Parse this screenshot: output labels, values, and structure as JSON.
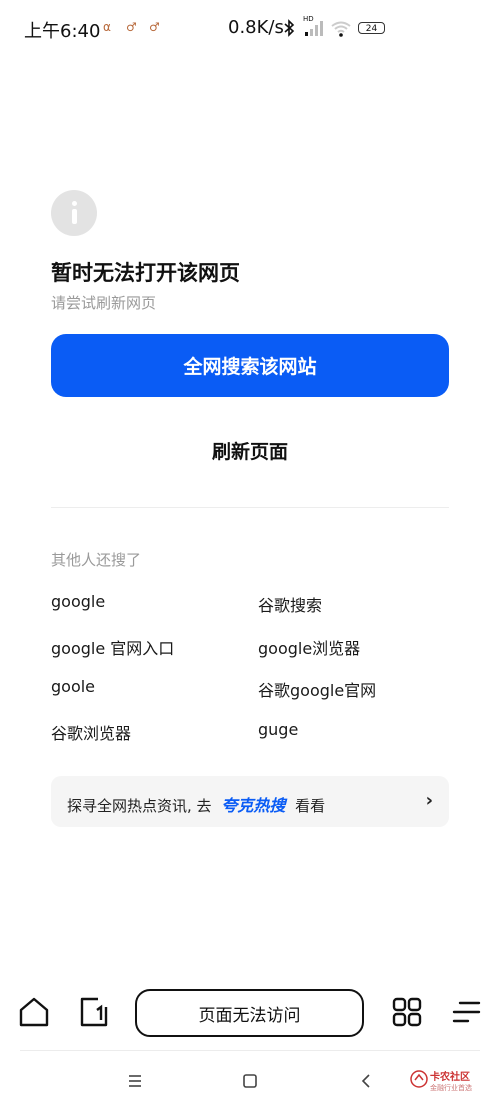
{
  "status_bar": {
    "time": "上午6:40",
    "mini_icons": [
      "α",
      "♂",
      "♂"
    ],
    "net_speed": "0.8K/s",
    "signal_label": "HD",
    "battery": "24"
  },
  "error": {
    "title": "暂时无法打开该网页",
    "subtitle": "请尝试刷新网页",
    "search_button": "全网搜索该网站",
    "refresh_button": "刷新页面"
  },
  "suggestions": {
    "title": "其他人还搜了",
    "items": [
      "google",
      "谷歌搜索",
      "google 官网入口",
      "google浏览器",
      "goole",
      "谷歌google官网",
      "谷歌浏览器",
      "guge"
    ]
  },
  "hot_bar": {
    "prefix": "探寻全网热点资讯, 去",
    "brand": "夸克热搜",
    "suffix": "看看",
    "chevron": "›"
  },
  "toolbar": {
    "address_text": "页面无法访问"
  },
  "watermark": {
    "text": "卡农社区",
    "sub": "金融行业首选"
  },
  "colors": {
    "accent": "#0a5cf5",
    "muted_text": "#9a9a9a"
  }
}
